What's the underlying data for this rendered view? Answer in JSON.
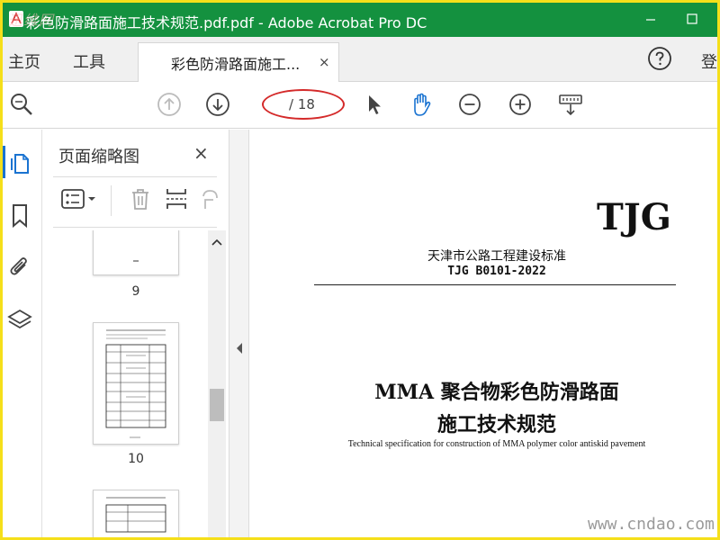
{
  "window": {
    "title": "彩色防滑路面施工技术规范.pdf.pdf - Adobe Acrobat Pro DC",
    "corner_watermark": "迅维网"
  },
  "tabs": {
    "home": "主页",
    "tools": "工具",
    "document_tab": "彩色防滑路面施工...",
    "document_close": "×",
    "login": "登"
  },
  "toolbar": {
    "page_value": "/ 18"
  },
  "panel": {
    "title": "页面缩略图",
    "close": "×",
    "pages": [
      "9",
      "10"
    ]
  },
  "document": {
    "brand": "TJG",
    "standard_name": "天津市公路工程建设标准",
    "standard_code": "TJG B0101-2022",
    "title_line1": "MMA 聚合物彩色防滑路面",
    "title_line2": "施工技术规范",
    "title_en": "Technical specification for construction of MMA polymer color antiskid pavement"
  },
  "watermark": "www.cndao.com",
  "colors": {
    "titlebar": "#14913f",
    "frame": "#f5df1a",
    "accent": "#1a73d1",
    "annotation": "#d42a2a"
  }
}
